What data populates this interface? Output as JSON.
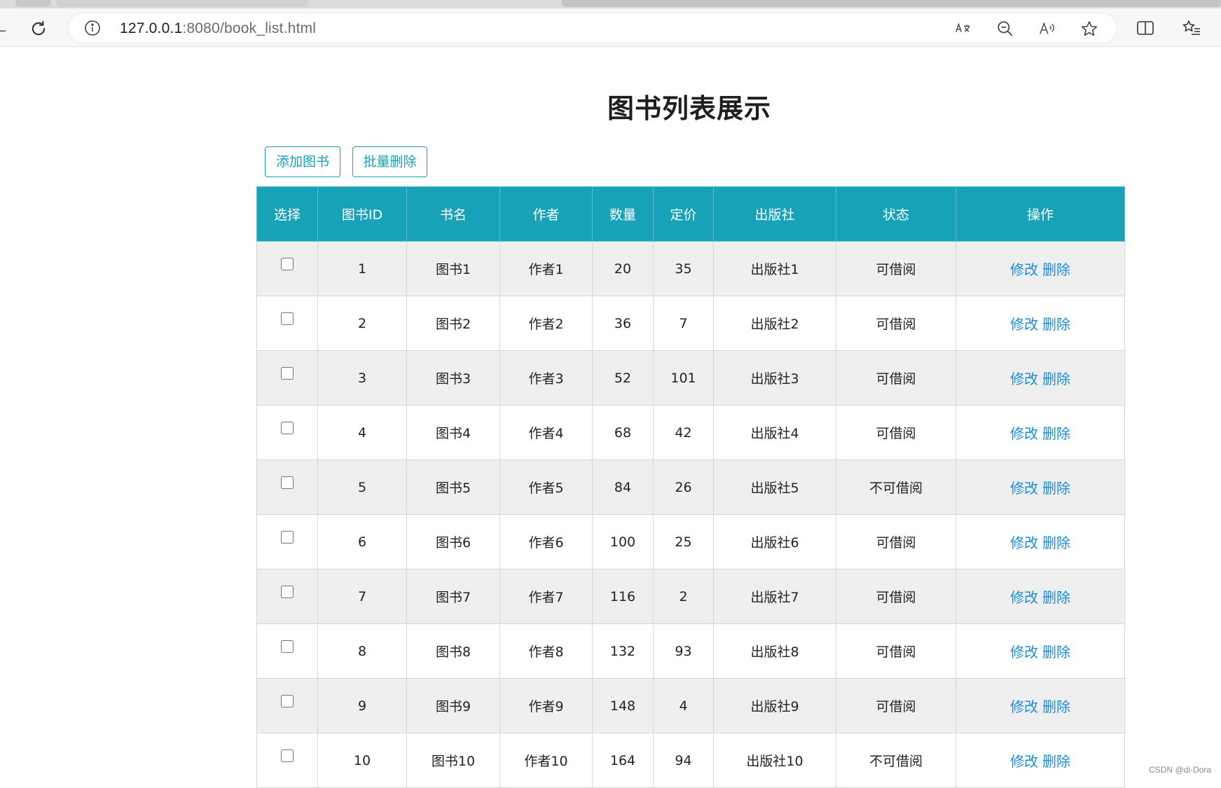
{
  "browser": {
    "url_host": "127.0.0.1",
    "url_path": ":8080/book_list.html"
  },
  "page": {
    "title": "图书列表展示",
    "add_button": "添加图书",
    "batch_delete_button": "批量删除"
  },
  "table": {
    "headers": [
      "选择",
      "图书ID",
      "书名",
      "作者",
      "数量",
      "定价",
      "出版社",
      "状态",
      "操作"
    ],
    "edit_label": "修改",
    "delete_label": "删除",
    "rows": [
      {
        "id": "1",
        "name": "图书1",
        "author": "作者1",
        "count": "20",
        "price": "35",
        "publisher": "出版社1",
        "status": "可借阅"
      },
      {
        "id": "2",
        "name": "图书2",
        "author": "作者2",
        "count": "36",
        "price": "7",
        "publisher": "出版社2",
        "status": "可借阅"
      },
      {
        "id": "3",
        "name": "图书3",
        "author": "作者3",
        "count": "52",
        "price": "101",
        "publisher": "出版社3",
        "status": "可借阅"
      },
      {
        "id": "4",
        "name": "图书4",
        "author": "作者4",
        "count": "68",
        "price": "42",
        "publisher": "出版社4",
        "status": "可借阅"
      },
      {
        "id": "5",
        "name": "图书5",
        "author": "作者5",
        "count": "84",
        "price": "26",
        "publisher": "出版社5",
        "status": "不可借阅"
      },
      {
        "id": "6",
        "name": "图书6",
        "author": "作者6",
        "count": "100",
        "price": "25",
        "publisher": "出版社6",
        "status": "可借阅"
      },
      {
        "id": "7",
        "name": "图书7",
        "author": "作者7",
        "count": "116",
        "price": "2",
        "publisher": "出版社7",
        "status": "可借阅"
      },
      {
        "id": "8",
        "name": "图书8",
        "author": "作者8",
        "count": "132",
        "price": "93",
        "publisher": "出版社8",
        "status": "可借阅"
      },
      {
        "id": "9",
        "name": "图书9",
        "author": "作者9",
        "count": "148",
        "price": "4",
        "publisher": "出版社9",
        "status": "可借阅"
      },
      {
        "id": "10",
        "name": "图书10",
        "author": "作者10",
        "count": "164",
        "price": "94",
        "publisher": "出版社10",
        "status": "不可借阅"
      }
    ]
  },
  "watermark": "CSDN @di-Dora",
  "colors": {
    "accent": "#17a2b8",
    "link": "#1a8cdb",
    "row_alt": "#efefef"
  }
}
